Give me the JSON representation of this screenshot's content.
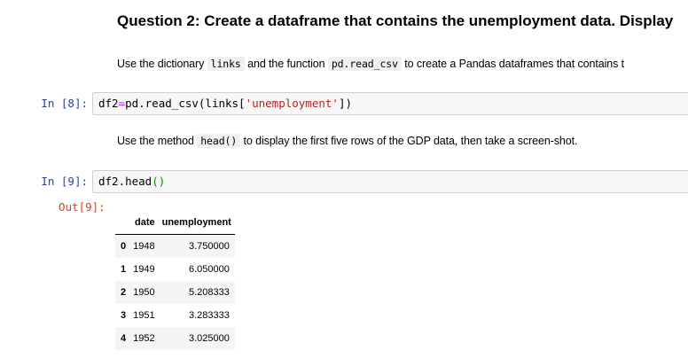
{
  "question": {
    "heading": "Question 2: Create a dataframe that contains the unemployment data. Display"
  },
  "md1": {
    "pre": "Use the dictionary ",
    "code1": "links",
    "mid": " and the function ",
    "code2": "pd.read_csv",
    "post": " to create a Pandas dataframes that contains t"
  },
  "cell8": {
    "prompt": "In [8]:",
    "var": "df2",
    "eq": "=",
    "call": "pd.read_csv(links[",
    "str": "'unemployment'",
    "close": "])"
  },
  "md2": {
    "pre": "Use the method ",
    "code": "head()",
    "post": " to display the first five rows of the GDP data, then take a screen-shot."
  },
  "cell9": {
    "prompt": "In [9]:",
    "code": "df2.head",
    "paren": "()"
  },
  "out9": {
    "prompt": "Out[9]:"
  },
  "table": {
    "headers": [
      "",
      "date",
      "unemployment"
    ],
    "rows": [
      {
        "index": "0",
        "date": "1948",
        "unemployment": "3.750000"
      },
      {
        "index": "1",
        "date": "1949",
        "unemployment": "6.050000"
      },
      {
        "index": "2",
        "date": "1950",
        "unemployment": "5.208333"
      },
      {
        "index": "3",
        "date": "1951",
        "unemployment": "3.283333"
      },
      {
        "index": "4",
        "date": "1952",
        "unemployment": "3.025000"
      }
    ]
  }
}
